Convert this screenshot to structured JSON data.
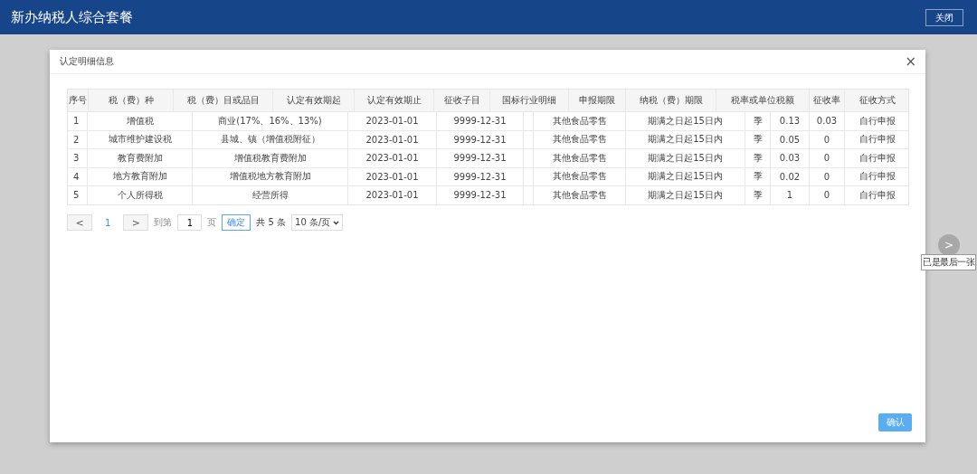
{
  "header": {
    "title": "新办纳税人综合套餐",
    "close_button": "关闭"
  },
  "dialog": {
    "title": "认定明细信息",
    "close_icon": "×",
    "confirm_button": "确认"
  },
  "table": {
    "columns": [
      "序号",
      "税（费）种",
      "税（费）目或品目",
      "认定有效期起",
      "认定有效期止",
      "征收子目",
      "国标行业明细",
      "申报期限",
      "纳税（费）期限",
      "税率或单位税额",
      "征收率",
      "征收方式"
    ],
    "rows": [
      {
        "seq": "1",
        "tax_type": "增值税",
        "item": "商业(17%、16%、13%)",
        "valid_from": "2023-01-01",
        "valid_to": "9999-12-31",
        "industry": "其他食品零售",
        "deadline": "期满之日起15日内",
        "period": "季",
        "rate": "0.13",
        "collection_rate": "0.03",
        "method": "自行申报"
      },
      {
        "seq": "2",
        "tax_type": "城市维护建设税",
        "item": "县城、镇（增值税附征）",
        "valid_from": "2023-01-01",
        "valid_to": "9999-12-31",
        "industry": "其他食品零售",
        "deadline": "期满之日起15日内",
        "period": "季",
        "rate": "0.05",
        "collection_rate": "0",
        "method": "自行申报"
      },
      {
        "seq": "3",
        "tax_type": "教育费附加",
        "item": "增值税教育费附加",
        "valid_from": "2023-01-01",
        "valid_to": "9999-12-31",
        "industry": "其他食品零售",
        "deadline": "期满之日起15日内",
        "period": "季",
        "rate": "0.03",
        "collection_rate": "0",
        "method": "自行申报"
      },
      {
        "seq": "4",
        "tax_type": "地方教育附加",
        "item": "增值税地方教育附加",
        "valid_from": "2023-01-01",
        "valid_to": "9999-12-31",
        "industry": "其他食品零售",
        "deadline": "期满之日起15日内",
        "period": "季",
        "rate": "0.02",
        "collection_rate": "0",
        "method": "自行申报"
      },
      {
        "seq": "5",
        "tax_type": "个人所得税",
        "item": "经营所得",
        "valid_from": "2023-01-01",
        "valid_to": "9999-12-31",
        "industry": "其他食品零售",
        "deadline": "期满之日起15日内",
        "period": "季",
        "rate": "1",
        "collection_rate": "0",
        "method": "自行申报"
      }
    ]
  },
  "pagination": {
    "prev": "<",
    "pages": [
      {
        "label": "1",
        "selected": true
      }
    ],
    "next": ">",
    "goto_label": "到第",
    "goto_value": "1",
    "page_unit": "页",
    "go_button": "确定",
    "total": "共 5 条",
    "page_size": "10 条/页"
  },
  "carousel": {
    "next": ">",
    "tooltip": "已是最后一张"
  }
}
